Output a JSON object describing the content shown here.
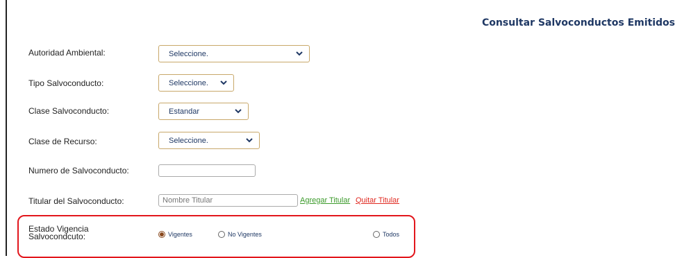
{
  "page": {
    "title": "Consultar Salvoconductos Emitidos"
  },
  "fields": {
    "autoridad": {
      "label": "Autoridad Ambiental:",
      "value": "Seleccione."
    },
    "tipo": {
      "label": "Tipo Salvoconducto:",
      "value": "Seleccione."
    },
    "clase": {
      "label": "Clase Salvoconducto:",
      "value": "Estandar"
    },
    "recurso": {
      "label": "Clase de Recurso:",
      "value": "Seleccione."
    },
    "numero": {
      "label": "Numero de Salvoconducto:",
      "value": "",
      "placeholder": ""
    },
    "titular": {
      "label": "Titular del Salvoconducto:",
      "value": "",
      "placeholder": "Nombre Titular"
    }
  },
  "links": {
    "add": "Agregar Titular",
    "remove": "Quitar Titular"
  },
  "estado": {
    "label_line1": "Estado Vigencia",
    "label_line2": "Salvocondcuto:",
    "options": [
      {
        "label": "Vigentes",
        "selected": true
      },
      {
        "label": "No Vigentes",
        "selected": false
      },
      {
        "label": "Todos",
        "selected": false
      }
    ]
  },
  "colors": {
    "title": "#1f3864",
    "select_border": "#c8a86a",
    "link_add": "#3b9a2a",
    "link_remove": "#e0281f",
    "highlight": "#e2161c"
  },
  "icons": {
    "select_arrow": "chevron-down-icon",
    "radio": "radio-icon"
  }
}
